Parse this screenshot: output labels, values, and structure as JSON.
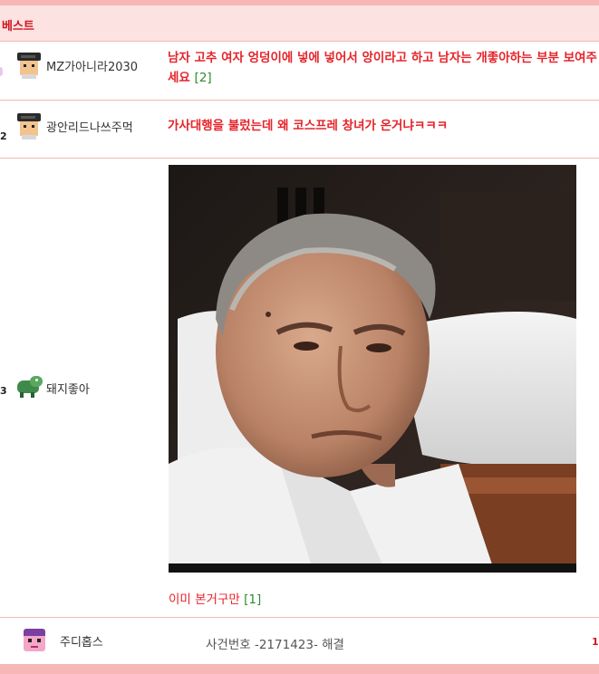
{
  "header": {
    "title": "베스트"
  },
  "posts": [
    {
      "mark": "",
      "nickname": "MZ가아니라2030",
      "title": "남자 고추 여자 엉덩이에 넣에 넣어서 앙이라고 하고 남자는 개좋아하는 부분 보여주세요",
      "comments": "[2]"
    },
    {
      "mark": "2",
      "nickname": "광안리드나쓰주먹",
      "title": "가사대행을 불렀는데 왜 코스프레 창녀가 온거냐ㅋㅋㅋ",
      "comments": ""
    },
    {
      "mark": "3",
      "nickname": "돼지좋아",
      "caption": "이미 본거구만",
      "comments": "[1]"
    },
    {
      "nickname": "주디홉스",
      "text": "사건번호 -2171423- 해결",
      "right_mark": "1"
    }
  ],
  "colors": {
    "accent_red": "#e5242a",
    "header_bg": "#fde2e2",
    "border_pink": "#f7b7b7",
    "comment_green": "#2e8b2e"
  }
}
